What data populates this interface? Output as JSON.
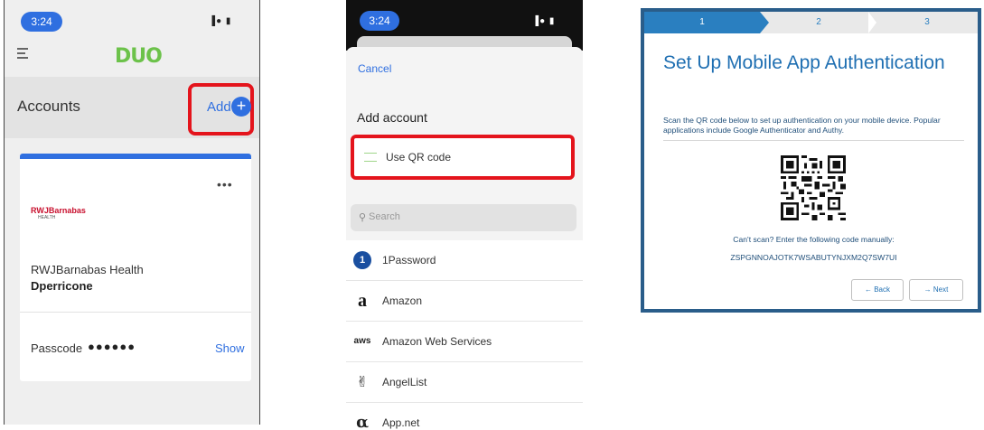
{
  "duo_screen": {
    "time": "3:24",
    "status_icons": "▐● ▮",
    "logo": "DUO",
    "accounts_title": "Accounts",
    "add_label": "Add",
    "plus": "+",
    "more": "•••",
    "org_logo_text": "RWJBarnabas",
    "org_logo_sub": "HEALTH",
    "org_name": "RWJBarnabas Health",
    "username": "Dperricone",
    "passcode_label": "Passcode",
    "passcode_dots": "●●●●●●",
    "show_label": "Show"
  },
  "add_account_screen": {
    "time": "3:24",
    "status_icons": "▐● ▮",
    "cancel_label": "Cancel",
    "title": "Add account",
    "qr_label": "Use QR code",
    "search_icon": "search-icon",
    "search_placeholder": "Search",
    "services": [
      {
        "label": "1Password",
        "icon": "1password-icon",
        "glyph": "1"
      },
      {
        "label": "Amazon",
        "icon": "amazon-icon",
        "glyph": "a"
      },
      {
        "label": "Amazon Web Services",
        "icon": "aws-icon",
        "glyph": "aws"
      },
      {
        "label": "AngelList",
        "icon": "angellist-icon",
        "glyph": "✌"
      },
      {
        "label": "App.net",
        "icon": "appnet-icon",
        "glyph": "α"
      }
    ]
  },
  "setup_screen": {
    "steps": [
      "1",
      "2",
      "3"
    ],
    "title": "Set Up Mobile App Authentication",
    "description": "Scan the QR code below to set up authentication on your mobile device. Popular applications include Google Authenticator and Authy.",
    "cant_scan": "Can't scan? Enter the following code manually:",
    "manual_code": "ZSPGNNOAJOTK7WSABUTYNJXM2Q7SW7UI",
    "back_label": "← Back",
    "next_label": "→ Next"
  },
  "colors": {
    "accent_blue": "#2f6fe0",
    "highlight_red": "#e4141c",
    "duo_green": "#6cc24a",
    "setup_blue": "#1f6fb2"
  }
}
